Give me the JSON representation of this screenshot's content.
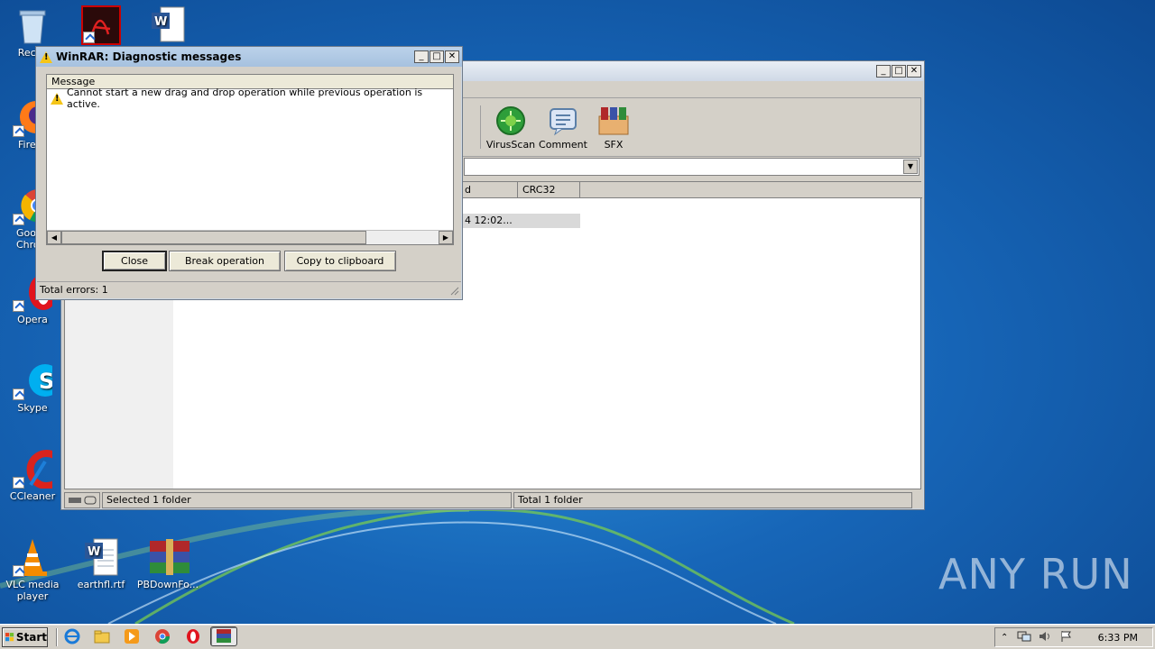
{
  "desktop": {
    "icons": [
      {
        "label": "Recycle Bin",
        "visible_label": "Recyc"
      },
      {
        "label": "",
        "visible_label": ""
      },
      {
        "label": "",
        "visible_label": ""
      },
      {
        "label": "Firefox",
        "visible_label": "Fire"
      },
      {
        "label": "Google Chrome",
        "visible_label": "Goo\nChro"
      },
      {
        "label": "Opera",
        "visible_label": "Opera"
      },
      {
        "label": "Skype",
        "visible_label": "Skype"
      },
      {
        "label": "CCleaner",
        "visible_label": "CCleaner"
      },
      {
        "label": "VLC media player",
        "visible_label": "VLC media\nplayer"
      },
      {
        "label": "earthfl.rtf",
        "visible_label": "earthfl.rtf"
      },
      {
        "label": "PBDownFo...",
        "visible_label": "PBDownFo..."
      }
    ],
    "watermark": "ANY RUN"
  },
  "winrar_main": {
    "toolbar": [
      {
        "label": "VirusScan",
        "icon": "virusscan-icon"
      },
      {
        "label": "Comment",
        "icon": "comment-icon"
      },
      {
        "label": "SFX",
        "icon": "sfx-icon"
      }
    ],
    "columns": [
      "d",
      "CRC32"
    ],
    "row_modified": "4 12:02...",
    "status_left": "Selected 1 folder",
    "status_right": "Total 1 folder"
  },
  "dialog": {
    "title": "WinRAR: Diagnostic messages",
    "column_header": "Message",
    "message": "Cannot start a new drag and drop operation while previous operation is active.",
    "buttons": {
      "close": "Close",
      "break": "Break operation",
      "copy": "Copy to clipboard"
    },
    "status": "Total errors: 1"
  },
  "taskbar": {
    "start_label": "Start",
    "clock": "6:33 PM"
  },
  "colors": {
    "accent_green": "#2e9e3a",
    "warning_yellow": "#f5c518",
    "desktop_blue": "#1766b8"
  }
}
